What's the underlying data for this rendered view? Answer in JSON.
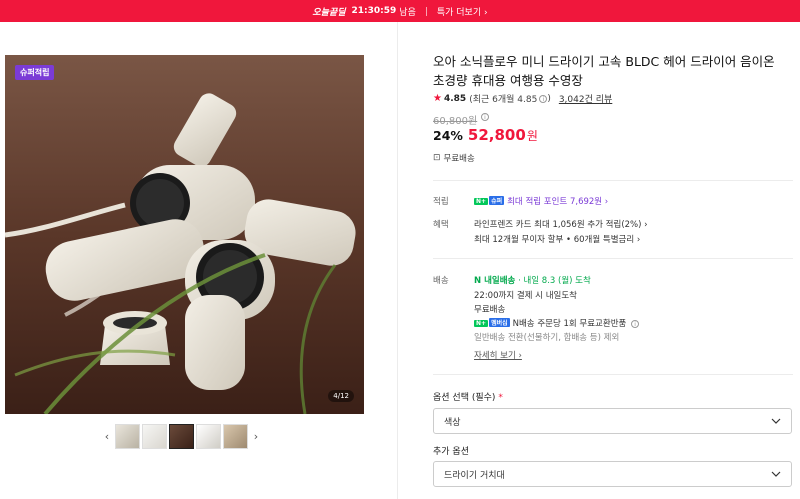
{
  "topbar": {
    "brand": "오늘끝딜",
    "timer": "21:30:59",
    "timer_suffix": "남음",
    "deal_link": "특가 더보기 ›"
  },
  "gallery": {
    "badge": "슈퍼적립",
    "counter": "4/12",
    "prev_arrow": "‹",
    "next_arrow": "›",
    "thumb_count": 5,
    "active_thumb": 3
  },
  "product": {
    "title": "오아 소닉플로우 미니 드라이기 고속 BLDC 헤어 드라이어 음이온 초경량 휴대용 여행용 수영장",
    "rating": "4.85",
    "rating_recent": "(최근 6개월 4.85",
    "rating_recent_close": ")",
    "reviews": "3,042건 리뷰",
    "original_price": "60,800원",
    "discount": "24%",
    "price": "52,800",
    "price_unit": "원",
    "free_shipping": "무료배송"
  },
  "points": {
    "label": "적립",
    "badge_n": "N+",
    "badge_super": "슈퍼",
    "text": "최대 적립 포인트 7,692원 ›"
  },
  "benefits": {
    "label": "혜택",
    "line1": "라인프렌즈 카드 최대 1,056원 추가 적립(2%) ›",
    "line2": "최대 12개월 무이자 할부 • 60개월 특별금리 ›"
  },
  "delivery": {
    "label": "배송",
    "badge": "N 내일배송",
    "arrival": "· 내일 8.3 (월) 도착",
    "cutoff": "22:00까지 결제 시 내일도착",
    "free": "무료배송",
    "exchange_badge_n": "N+",
    "exchange_badge_membership": "멤버십",
    "exchange": "N배송 주문당 1회 무료교환반품",
    "exchange_note": "일반배송 전환(선물하기, 합배송 등) 제외",
    "more": "자세히 보기 ›"
  },
  "options": {
    "required_label": "옵션 선택 (필수)",
    "required_mark": "*",
    "required_value": "색상",
    "extra_label": "추가 옵션",
    "extra_value": "드라이기 거치대"
  },
  "colors": {
    "accent": "#f0173c",
    "points": "#7b3bd6",
    "npay": "#03c75a"
  }
}
